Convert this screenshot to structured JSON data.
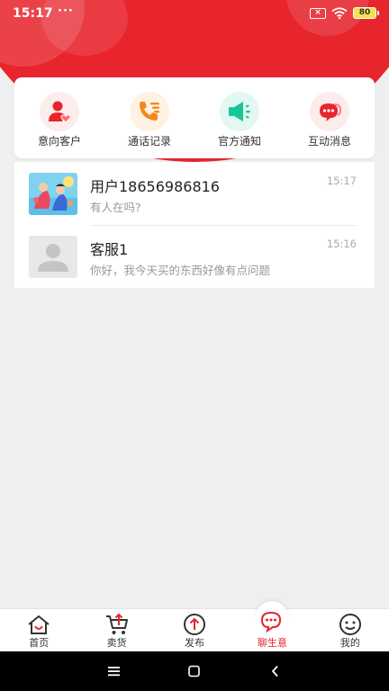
{
  "status_bar": {
    "time": "15:17",
    "dots": "···",
    "battery": "80"
  },
  "quick_actions": [
    {
      "label": "意向客户",
      "icon": "interested-customer-icon",
      "color": "#e8242d"
    },
    {
      "label": "通话记录",
      "icon": "call-log-icon",
      "color": "#f08a1c"
    },
    {
      "label": "官方通知",
      "icon": "megaphone-icon",
      "color": "#16c79a"
    },
    {
      "label": "互动消息",
      "icon": "chat-bubbles-icon",
      "color": "#e8242d"
    }
  ],
  "conversations": [
    {
      "name": "用户18656986816",
      "preview": "有人在吗?",
      "time": "15:17",
      "avatar": "illustrated-avatar"
    },
    {
      "name": "客服1",
      "preview": "你好，我今天买的东西好像有点问题",
      "time": "15:16",
      "avatar": "default-person-avatar"
    }
  ],
  "tabs": [
    {
      "label": "首页",
      "icon": "home-icon",
      "active": false
    },
    {
      "label": "卖货",
      "icon": "cart-upload-icon",
      "active": false
    },
    {
      "label": "发布",
      "icon": "publish-arrow-icon",
      "active": false
    },
    {
      "label": "聊生意",
      "icon": "chat-bubble-icon",
      "active": true
    },
    {
      "label": "我的",
      "icon": "smiley-icon",
      "active": false
    }
  ],
  "theme": {
    "brand_red": "#e8242d"
  }
}
